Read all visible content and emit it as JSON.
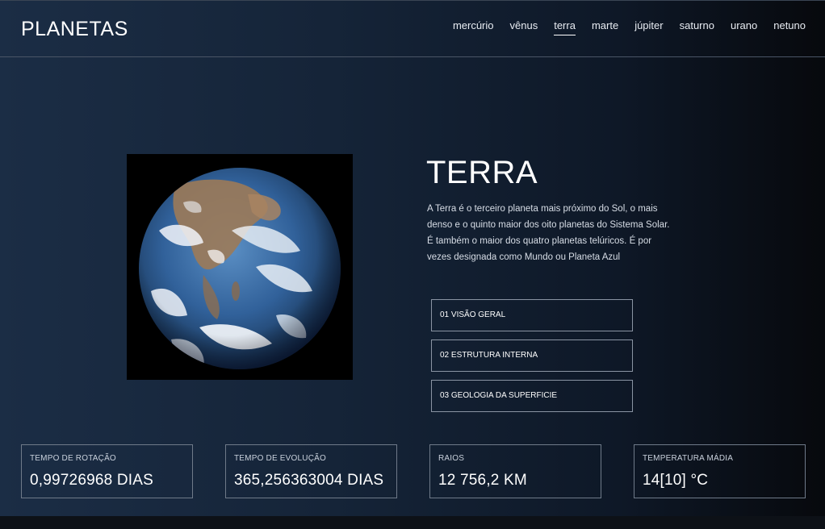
{
  "header": {
    "logo": "PLANETAS",
    "nav": [
      "mercúrio",
      "vênus",
      "terra",
      "marte",
      "júpiter",
      "saturno",
      "urano",
      "netuno"
    ],
    "active": "terra"
  },
  "planet": {
    "name": "TERRA",
    "description": "A Terra é o terceiro planeta mais próximo do Sol, o mais denso e o quinto maior dos oito planetas do Sistema Solar. É também o maior dos quatro planetas telúricos. É por vezes designada como Mundo ou Planeta Azul"
  },
  "tabs": [
    "01 VISÃO GERAL",
    "02 ESTRUTURA INTERNA",
    "03 GEOLOGIA DA SUPERFICIE"
  ],
  "stats": [
    {
      "label": "TEMPO DE ROTAÇÃO",
      "value": "0,99726968 DIAS"
    },
    {
      "label": "TEMPO DE EVOLUÇÃO",
      "value": "365,256363004 DIAS"
    },
    {
      "label": "RAIOS",
      "value": "12 756,2 KM"
    },
    {
      "label": "TEMPERATURA MÁDIA",
      "value": "14[10] °C"
    }
  ],
  "colors": {
    "background_start": "#1b2d45",
    "background_end": "#07090d",
    "ocean": "#2f5f95",
    "border": "#8a94a3"
  }
}
